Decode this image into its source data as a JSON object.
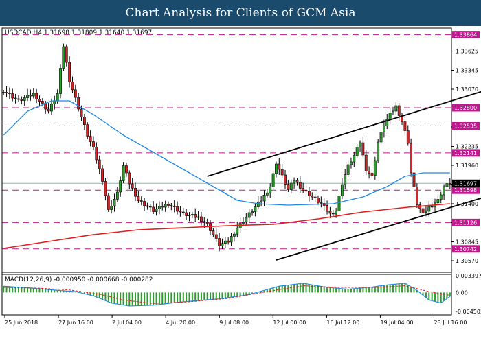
{
  "banner": {
    "title": "Chart Analysis for Clients of GCM Asia"
  },
  "colors": {
    "banner_bg": "#1a4a6c",
    "bull": "#2ca02c",
    "bear": "#d62728",
    "ma_fast": "#1e88e5",
    "ma_slow": "#e31a1c",
    "level": "#c2188f",
    "current": "#000000",
    "macd_hist": "#2e9e2e",
    "macd_signal": "#e31a1c"
  },
  "chart_data": {
    "type": "candlestick",
    "symbol_header": "USDCAD,H4  1.31698 1.31809 1.31640 1.31697",
    "ylim": [
      1.3042,
      1.3391
    ],
    "y_ticks": [
      1.33625,
      1.33345,
      1.3307,
      1.32795,
      1.3252,
      1.32235,
      1.3196,
      1.31685,
      1.314,
      1.31125,
      1.30845,
      1.3057
    ],
    "x_ticks": [
      "25 Jun 2018",
      "27 Jun 16:00",
      "2 Jul 04:00",
      "4 Jul 20:00",
      "9 Jul 08:00",
      "12 Jul 00:00",
      "16 Jul 12:00",
      "19 Jul 04:00",
      "23 Jul 16:00"
    ],
    "levels": [
      {
        "value": 1.33864,
        "label": "1.33864"
      },
      {
        "value": 1.328,
        "label": "1.32800"
      },
      {
        "value": 1.32535,
        "label": "1.32535"
      },
      {
        "value": 1.32141,
        "label": "1.32141"
      },
      {
        "value": 1.31598,
        "label": "1.31598"
      },
      {
        "value": 1.31126,
        "label": "1.31126"
      },
      {
        "value": 1.30742,
        "label": "1.30742"
      }
    ],
    "current_price": {
      "value": 1.31697,
      "label": "1.31697"
    },
    "close_path": [
      {
        "i": 0,
        "c": 1.3305
      },
      {
        "i": 5,
        "c": 1.329
      },
      {
        "i": 10,
        "c": 1.33
      },
      {
        "i": 15,
        "c": 1.3275
      },
      {
        "i": 18,
        "c": 1.33
      },
      {
        "i": 20,
        "c": 1.337
      },
      {
        "i": 22,
        "c": 1.332
      },
      {
        "i": 25,
        "c": 1.328
      },
      {
        "i": 28,
        "c": 1.324
      },
      {
        "i": 30,
        "c": 1.322
      },
      {
        "i": 31,
        "c": 1.3205
      },
      {
        "i": 33,
        "c": 1.3175
      },
      {
        "i": 35,
        "c": 1.313
      },
      {
        "i": 38,
        "c": 1.3155
      },
      {
        "i": 40,
        "c": 1.3195
      },
      {
        "i": 42,
        "c": 1.317
      },
      {
        "i": 45,
        "c": 1.3145
      },
      {
        "i": 50,
        "c": 1.313
      },
      {
        "i": 55,
        "c": 1.314
      },
      {
        "i": 60,
        "c": 1.3125
      },
      {
        "i": 65,
        "c": 1.312
      },
      {
        "i": 68,
        "c": 1.311
      },
      {
        "i": 72,
        "c": 1.308
      },
      {
        "i": 75,
        "c": 1.3085
      },
      {
        "i": 78,
        "c": 1.3105
      },
      {
        "i": 82,
        "c": 1.3125
      },
      {
        "i": 86,
        "c": 1.3145
      },
      {
        "i": 89,
        "c": 1.3165
      },
      {
        "i": 91,
        "c": 1.32
      },
      {
        "i": 93,
        "c": 1.318
      },
      {
        "i": 95,
        "c": 1.316
      },
      {
        "i": 97,
        "c": 1.3175
      },
      {
        "i": 100,
        "c": 1.316
      },
      {
        "i": 103,
        "c": 1.315
      },
      {
        "i": 106,
        "c": 1.314
      },
      {
        "i": 109,
        "c": 1.3125
      },
      {
        "i": 111,
        "c": 1.313
      },
      {
        "i": 113,
        "c": 1.317
      },
      {
        "i": 115,
        "c": 1.3195
      },
      {
        "i": 117,
        "c": 1.321
      },
      {
        "i": 119,
        "c": 1.323
      },
      {
        "i": 121,
        "c": 1.319
      },
      {
        "i": 123,
        "c": 1.318
      },
      {
        "i": 125,
        "c": 1.323
      },
      {
        "i": 127,
        "c": 1.3255
      },
      {
        "i": 129,
        "c": 1.327
      },
      {
        "i": 131,
        "c": 1.3282
      },
      {
        "i": 133,
        "c": 1.326
      },
      {
        "i": 135,
        "c": 1.323
      },
      {
        "i": 136,
        "c": 1.3185
      },
      {
        "i": 138,
        "c": 1.314
      },
      {
        "i": 140,
        "c": 1.3125
      },
      {
        "i": 142,
        "c": 1.3135
      },
      {
        "i": 145,
        "c": 1.3145
      },
      {
        "i": 147,
        "c": 1.3165
      },
      {
        "i": 149,
        "c": 1.31697
      }
    ],
    "ma_fast": [
      {
        "i": 0,
        "v": 1.324
      },
      {
        "i": 8,
        "v": 1.3275
      },
      {
        "i": 16,
        "v": 1.329
      },
      {
        "i": 22,
        "v": 1.329
      },
      {
        "i": 30,
        "v": 1.327
      },
      {
        "i": 40,
        "v": 1.324
      },
      {
        "i": 50,
        "v": 1.3215
      },
      {
        "i": 60,
        "v": 1.319
      },
      {
        "i": 70,
        "v": 1.3165
      },
      {
        "i": 78,
        "v": 1.3145
      },
      {
        "i": 85,
        "v": 1.314
      },
      {
        "i": 95,
        "v": 1.3138
      },
      {
        "i": 110,
        "v": 1.314
      },
      {
        "i": 120,
        "v": 1.315
      },
      {
        "i": 128,
        "v": 1.3165
      },
      {
        "i": 134,
        "v": 1.318
      },
      {
        "i": 140,
        "v": 1.3185
      },
      {
        "i": 149,
        "v": 1.3185
      }
    ],
    "ma_slow": [
      {
        "i": 0,
        "v": 1.3075
      },
      {
        "i": 15,
        "v": 1.3085
      },
      {
        "i": 30,
        "v": 1.3095
      },
      {
        "i": 45,
        "v": 1.3102
      },
      {
        "i": 60,
        "v": 1.3105
      },
      {
        "i": 75,
        "v": 1.3108
      },
      {
        "i": 90,
        "v": 1.311
      },
      {
        "i": 105,
        "v": 1.3118
      },
      {
        "i": 120,
        "v": 1.3128
      },
      {
        "i": 135,
        "v": 1.3135
      },
      {
        "i": 149,
        "v": 1.314
      }
    ],
    "channel_lines": [
      {
        "name": "upper",
        "points": [
          {
            "i": 68,
            "v": 1.318
          },
          {
            "i": 168,
            "v": 1.3315
          }
        ]
      },
      {
        "name": "lower",
        "points": [
          {
            "i": 91,
            "v": 1.3058
          },
          {
            "i": 195,
            "v": 1.3195
          }
        ]
      }
    ],
    "macd": {
      "header": "MACD(12,26,9) -0.000950 -0.000668 -0.000282",
      "ylim": [
        -0.0045,
        0.00397
      ],
      "y_ticks": [
        {
          "value": 0.00397,
          "label": "0.003397"
        },
        {
          "value": 0.0,
          "label": "0.00"
        },
        {
          "value": -0.0045,
          "label": "-0.004505"
        }
      ],
      "macd_line": [
        {
          "i": 0,
          "v": 0.0015
        },
        {
          "i": 10,
          "v": 0.001
        },
        {
          "i": 18,
          "v": 0.0005
        },
        {
          "i": 24,
          "v": 0.0002
        },
        {
          "i": 30,
          "v": -0.0008
        },
        {
          "i": 36,
          "v": -0.0025
        },
        {
          "i": 42,
          "v": -0.0032
        },
        {
          "i": 50,
          "v": -0.003
        },
        {
          "i": 60,
          "v": -0.0022
        },
        {
          "i": 72,
          "v": -0.0015
        },
        {
          "i": 82,
          "v": -0.0005
        },
        {
          "i": 92,
          "v": 0.0015
        },
        {
          "i": 100,
          "v": 0.0022
        },
        {
          "i": 108,
          "v": 0.0012
        },
        {
          "i": 115,
          "v": 0.0008
        },
        {
          "i": 122,
          "v": 0.0012
        },
        {
          "i": 128,
          "v": 0.0018
        },
        {
          "i": 134,
          "v": 0.0022
        },
        {
          "i": 138,
          "v": 0.0005
        },
        {
          "i": 142,
          "v": -0.0018
        },
        {
          "i": 146,
          "v": -0.0025
        },
        {
          "i": 149,
          "v": -0.00095
        }
      ],
      "signal_line": [
        {
          "i": 0,
          "v": 0.0012
        },
        {
          "i": 12,
          "v": 0.001
        },
        {
          "i": 22,
          "v": 0.0006
        },
        {
          "i": 32,
          "v": -0.0004
        },
        {
          "i": 40,
          "v": -0.0018
        },
        {
          "i": 50,
          "v": -0.0026
        },
        {
          "i": 62,
          "v": -0.0022
        },
        {
          "i": 75,
          "v": -0.0014
        },
        {
          "i": 88,
          "v": 0.0002
        },
        {
          "i": 100,
          "v": 0.0016
        },
        {
          "i": 112,
          "v": 0.0012
        },
        {
          "i": 124,
          "v": 0.0012
        },
        {
          "i": 134,
          "v": 0.0016
        },
        {
          "i": 142,
          "v": 0.0002
        },
        {
          "i": 149,
          "v": -0.000668
        }
      ]
    }
  }
}
